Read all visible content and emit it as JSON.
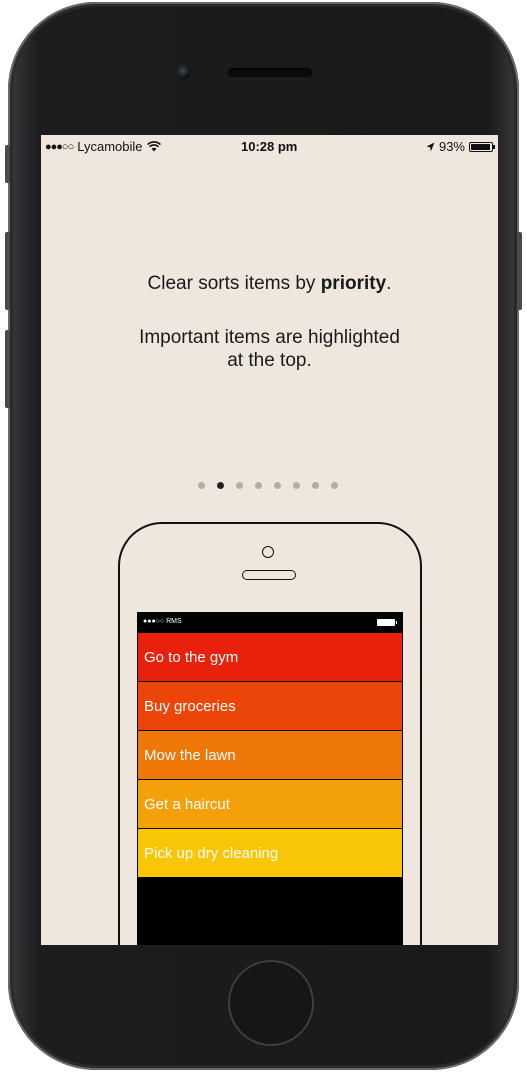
{
  "status_bar": {
    "signal_dots": "●●●○○",
    "carrier": "Lycamobile",
    "wifi_icon": "wifi-icon",
    "time": "10:28 pm",
    "location_icon": "location-arrow-icon",
    "battery_text": "93%",
    "battery_level": 0.93
  },
  "onboarding": {
    "line1_prefix": "Clear sorts items by ",
    "line1_bold": "priority",
    "line1_suffix": ".",
    "line2a": "Important items are highlighted",
    "line2b": "at the top.",
    "page_count": 8,
    "active_page": 2
  },
  "illustration": {
    "status": {
      "signal_dots": "●●●○○",
      "carrier": "RMS"
    },
    "tasks": [
      {
        "label": "Go to the gym",
        "color": "#e8200c"
      },
      {
        "label": "Buy groceries",
        "color": "#eb4608"
      },
      {
        "label": "Mow the lawn",
        "color": "#ef7708"
      },
      {
        "label": "Get a haircut",
        "color": "#f4a109"
      },
      {
        "label": "Pick up dry cleaning",
        "color": "#f8c604"
      }
    ]
  }
}
